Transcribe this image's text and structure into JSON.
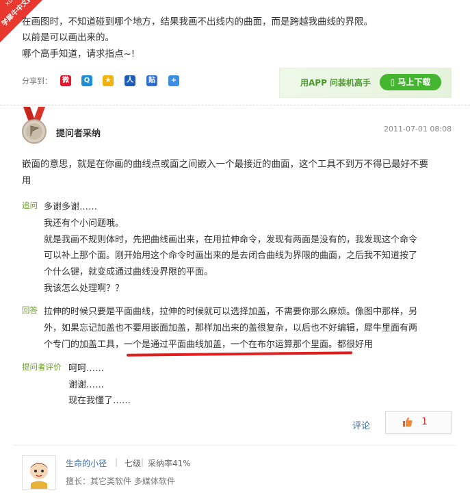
{
  "watermark": {
    "site_en": "xuexiniu",
    "site_cn": "学犀牛中文网"
  },
  "question": {
    "lines": [
      "在画图时，不知道碰到哪个地方，结果我画不出线内的曲面，而是跨越我曲线的界限。",
      "以前是可以画出来的。",
      "哪个高手知道，请求指点~!"
    ],
    "share_label": "分享到：",
    "share_icons": [
      "weibo-icon",
      "qzone-icon",
      "qq-zone-star-icon",
      "renren-icon",
      "tieba-icon",
      "plus-icon"
    ]
  },
  "app_banner": {
    "text": "用APP 问装机高手",
    "button": "马上下载"
  },
  "answer": {
    "adopter_label": "提问者采纳",
    "date": "2011-07-01 08:08",
    "body": [
      "嵌面的意思，就是在你画的曲线点或面之间嵌入一个最接近的曲面，这个工具不到万不得已最好不要",
      "用"
    ],
    "followup_tag": "追问",
    "followup": [
      "多谢多谢……",
      "我还有个小问题哦。",
      "就是我画不规则体时，先把曲线画出来，在用拉伸命令，发现有两面是没有的，我发现这个命令",
      "可以补上那个面。刚开始用这个命令时画出来的是去闭合曲线为界限的曲面，之后我不知道按了",
      "个什么键，就变成通过曲线没界限的平面。",
      "我该怎么处理啊？？"
    ],
    "reply_tag": "回答",
    "reply": [
      "拉伸的时候只要是平面曲线，拉伸的时候就可以选择加盖，不需要你那么麻烦。像图中那样，另",
      "外，如果忘记加盖也不要用嵌面加盖，那样加出来的盖很复杂，以后也不好编辑，犀牛里面有两",
      "个专门的加盖工具，一个是通过平面曲线加盖，一个在布尔运算那个里面。都很好用"
    ],
    "eval_tag": "提问者评价",
    "eval": [
      "呵呵……",
      "谢谢……",
      "现在我懂了……"
    ],
    "comment_label": "评论",
    "vote_count": "1"
  },
  "user": {
    "name": "生命的小径",
    "level": "七级",
    "adopt_rate": "采纳率41%",
    "expertise": "擅长：其它类软件 多媒体软件"
  },
  "colors": {
    "accent_green": "#6a9b2a",
    "link_blue": "#3a6aa8",
    "red_marker": "#e02020",
    "download_green": "#43b52f"
  }
}
